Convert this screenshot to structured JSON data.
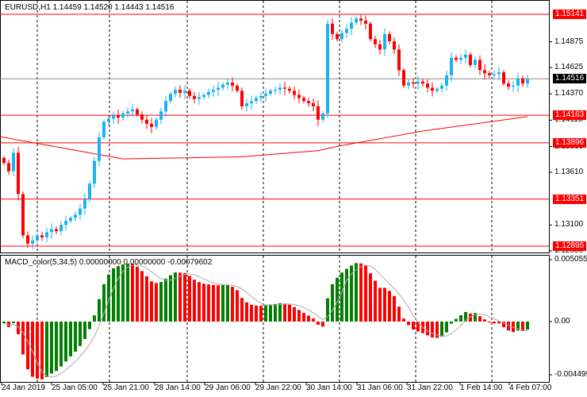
{
  "header": {
    "title": "EURUSD,H1  1.14459 1.14520 1.14443 1.14516"
  },
  "macd": {
    "title": "MACD_color(5,34,5) 0.00000000 0.00000000 -0.00079602",
    "ticks": [
      "0.0050553",
      "0.00",
      "-0.004499"
    ],
    "fast": 5,
    "slow": 34,
    "signal": 5,
    "max": 0.0050553,
    "min": -0.004499
  },
  "price_axis": {
    "max": 1.15141,
    "min": 1.12895,
    "ticks": [
      "1.14875",
      "1.14625",
      "1.14370",
      "1.14115",
      "1.13860",
      "1.13610",
      "1.13100",
      "1.12850"
    ],
    "levels": [
      "1.15141",
      "1.14163",
      "1.13896",
      "1.13351",
      "1.12895"
    ],
    "bid": "1.14516"
  },
  "time_axis": [
    "24 Jan 2019",
    "25 Jan 05:00",
    "25 Jan 21:00",
    "28 Jan 14:00",
    "29 Jan 06:00",
    "29 Jan 22:00",
    "30 Jan 14:00",
    "31 Jan 06:00",
    "31 Jan 22:00",
    "1 Feb 14:00",
    "4 Feb 07:00"
  ],
  "colors": {
    "bull": "#1ab2f0",
    "bear": "#ff0000",
    "level": "#ff0000",
    "macd_up": "#008000",
    "macd_down": "#ff0000"
  },
  "closes": [
    1.137,
    1.1362,
    1.138,
    1.134,
    1.13,
    1.1292,
    1.1295,
    1.13,
    1.1298,
    1.1303,
    1.1306,
    1.1304,
    1.131,
    1.1314,
    1.1317,
    1.132,
    1.1326,
    1.1335,
    1.135,
    1.1372,
    1.1395,
    1.141,
    1.1413,
    1.1416,
    1.1414,
    1.1418,
    1.142,
    1.1422,
    1.1417,
    1.1412,
    1.1408,
    1.1405,
    1.1412,
    1.142,
    1.143,
    1.1437,
    1.1441,
    1.1438,
    1.144,
    1.1435,
    1.1432,
    1.1434,
    1.1436,
    1.1439,
    1.1441,
    1.1443,
    1.1446,
    1.1448,
    1.1445,
    1.144,
    1.1425,
    1.1428,
    1.143,
    1.1433,
    1.1435,
    1.1437,
    1.144,
    1.1441,
    1.1443,
    1.1442,
    1.144,
    1.1436,
    1.1433,
    1.143,
    1.1428,
    1.1425,
    1.1412,
    1.1418,
    1.1505,
    1.1495,
    1.149,
    1.1496,
    1.15,
    1.1506,
    1.151,
    1.1508,
    1.1505,
    1.149,
    1.1485,
    1.148,
    1.1495,
    1.1488,
    1.148,
    1.146,
    1.1445,
    1.1448,
    1.1447,
    1.1449,
    1.1447,
    1.1443,
    1.144,
    1.1442,
    1.1445,
    1.1455,
    1.1472,
    1.147,
    1.1472,
    1.1475,
    1.1465,
    1.147,
    1.146,
    1.1457,
    1.1455,
    1.1456,
    1.1458,
    1.1447,
    1.1444,
    1.1445,
    1.1452,
    1.1447,
    1.14516
  ],
  "moving_average": [
    [
      0,
      1.13956
    ],
    [
      25,
      1.1374
    ],
    [
      50,
      1.1376
    ],
    [
      66,
      1.1382
    ],
    [
      71,
      1.1387
    ],
    [
      88,
      1.1401
    ],
    [
      110,
      1.1415
    ]
  ]
}
